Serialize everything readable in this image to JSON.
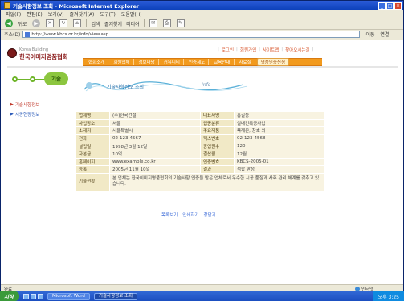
{
  "window": {
    "title": "기술사항정보 조회 - Microsoft Internet Explorer",
    "menu": [
      "파일(F)",
      "편집(E)",
      "보기(V)",
      "즐겨찾기(A)",
      "도구(T)",
      "도움말(H)"
    ],
    "toolbar": {
      "back_label": "뒤로",
      "search_label": "검색",
      "favorites_label": "즐겨찾기",
      "media_label": "미디어"
    },
    "address": {
      "label": "주소(D)",
      "value": "http://www.kbcs.or.kr/info/view.asp",
      "go_label": "이동",
      "links_label": "연결"
    }
  },
  "site": {
    "logo_small": "Korea Building",
    "logo_text": "한국이미지명품협회",
    "utility_links": [
      "로그인",
      "회원가입",
      "사이트맵",
      "찾아오시는길"
    ],
    "gnb": [
      "협회소개",
      "회원업체",
      "정보마당",
      "커뮤니티",
      "인증제도",
      "교육안내",
      "자료실",
      "명품인증신청"
    ],
    "section_badge": "기술",
    "banner_title": "기술사항정보 조회",
    "banner_side": "Info"
  },
  "lnb": [
    {
      "label": "기술사항정보",
      "active": true
    },
    {
      "label": "시공현장정보",
      "active": false
    }
  ],
  "info": {
    "rows": [
      [
        "업체명",
        "(주)한국건설",
        "대표자명",
        "홍길동"
      ],
      [
        "사업장소",
        "서울",
        "업종분류",
        "실내건축공사업"
      ],
      [
        "소재지",
        "서울특별시",
        "주요제품",
        "목재문, 창호 외"
      ],
      [
        "전화",
        "02-123-4567",
        "팩스번호",
        "02-123-4568"
      ],
      [
        "설립일",
        "1998년 3월 12일",
        "종업원수",
        "120"
      ],
      [
        "자본금",
        "10억",
        "결산월",
        "12월"
      ],
      [
        "홈페이지",
        "www.example.co.kr",
        "인증번호",
        "KBCS-2005-01"
      ],
      [
        "등록",
        "2005년 11월 10일",
        "결과",
        "적합 판정"
      ]
    ],
    "note_label": "기술현황",
    "note_value": "본 업체는 한국이미지명품협회의 기술사항 인증을 받은 업체로서 우수한 시공 품질과 사후 관리 체계를 갖추고 있습니다."
  },
  "bottom_links": [
    "목록보기",
    "인쇄하기",
    "창닫기"
  ],
  "statusbar": {
    "text": "완료",
    "zone": "인터넷"
  },
  "taskbar": {
    "start": "시작",
    "tasks": [
      "Microsoft Word",
      "기술사항정보 조회"
    ],
    "clock": "오후 3:25"
  }
}
